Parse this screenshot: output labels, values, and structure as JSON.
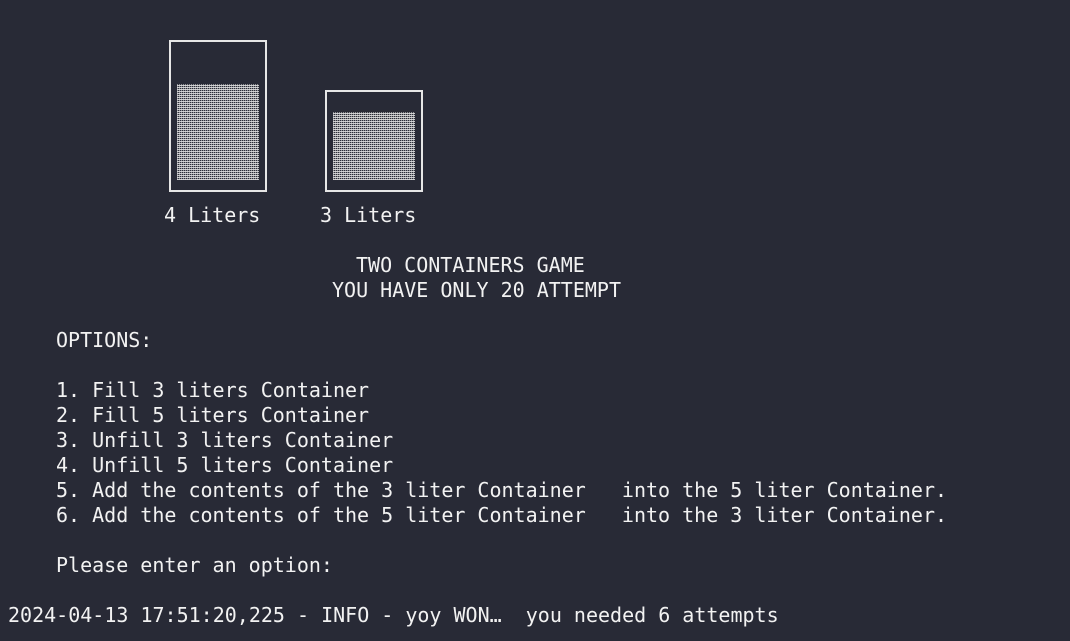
{
  "containers": [
    {
      "label": "4 Liters",
      "fill_fraction": 0.73
    },
    {
      "label": "3 Liters",
      "fill_fraction": 0.83
    }
  ],
  "title": "TWO CONTAINERS GAME",
  "attempts_line": "YOU HAVE ONLY 20 ATTEMPT",
  "options": {
    "heading": "OPTIONS:",
    "items": [
      "1. Fill 3 liters Container",
      "2. Fill 5 liters Container",
      "3. Unfill 3 liters Container",
      "4. Unfill 5 liters Container",
      "5. Add the contents of the 3 liter Container   into the 5 liter Container.",
      "6. Add the contents of the 5 liter Container   into the 3 liter Container."
    ]
  },
  "prompt": "Please enter an option:",
  "log_line": "2024-04-13 17:51:20,225 - INFO - yoy WON…  you needed 6 attempts"
}
